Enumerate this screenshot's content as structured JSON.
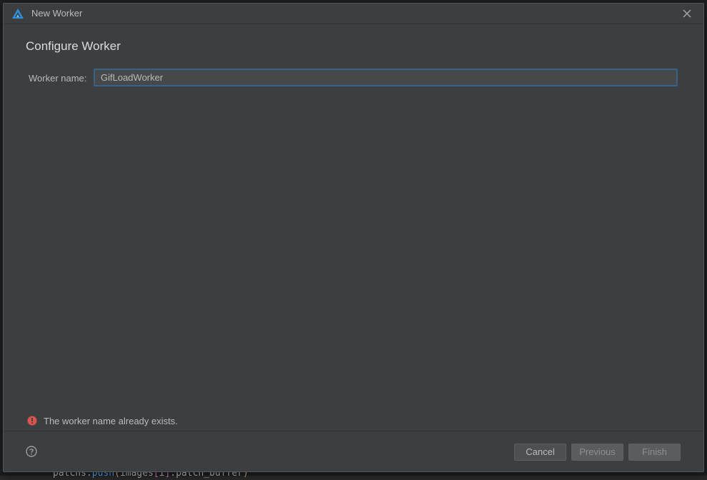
{
  "window": {
    "title": "New Worker",
    "logo_icon": "harmonyos-devstudio-logo-icon",
    "close_icon": "close-icon"
  },
  "page": {
    "heading": "Configure Worker"
  },
  "form": {
    "worker_name_label": "Worker name:",
    "worker_name_value": "GifLoadWorker"
  },
  "validation": {
    "error_icon": "error-icon",
    "error_color": "#d9534f",
    "message": "The worker name already exists."
  },
  "footer": {
    "help_icon": "help-icon",
    "cancel_label": "Cancel",
    "previous_label": "Previous",
    "finish_label": "Finish"
  },
  "background_code": {
    "obj": "patchs",
    "method": "push",
    "arg_a": "images",
    "index": "i",
    "arg_b": "patch_buffer"
  },
  "colors": {
    "dialog_bg": "#3c3f41",
    "input_focus_border": "#3d6185",
    "accent_logo": "#2f8fdc"
  }
}
